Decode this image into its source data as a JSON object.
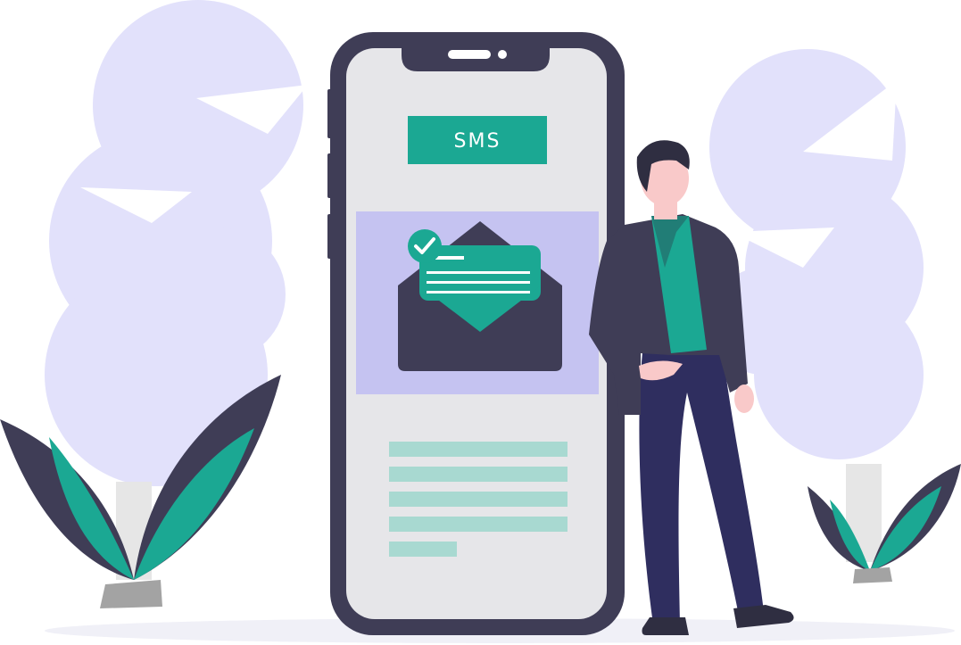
{
  "sms_badge": {
    "label": "SMS"
  },
  "illustration": {
    "icons": [
      "phone-icon",
      "envelope-icon",
      "check-icon",
      "person-icon",
      "tree-icon",
      "plant-icon"
    ],
    "colors": {
      "primary": "#3f3d56",
      "accent": "#1ba893",
      "screen": "#e6e6e9",
      "tree": "#e2e1fb",
      "message_panel": "#c5c3f1",
      "text_lines": "#a8d9d1",
      "pot": "#a3a3a3",
      "skin": "#f9c9c9"
    }
  }
}
